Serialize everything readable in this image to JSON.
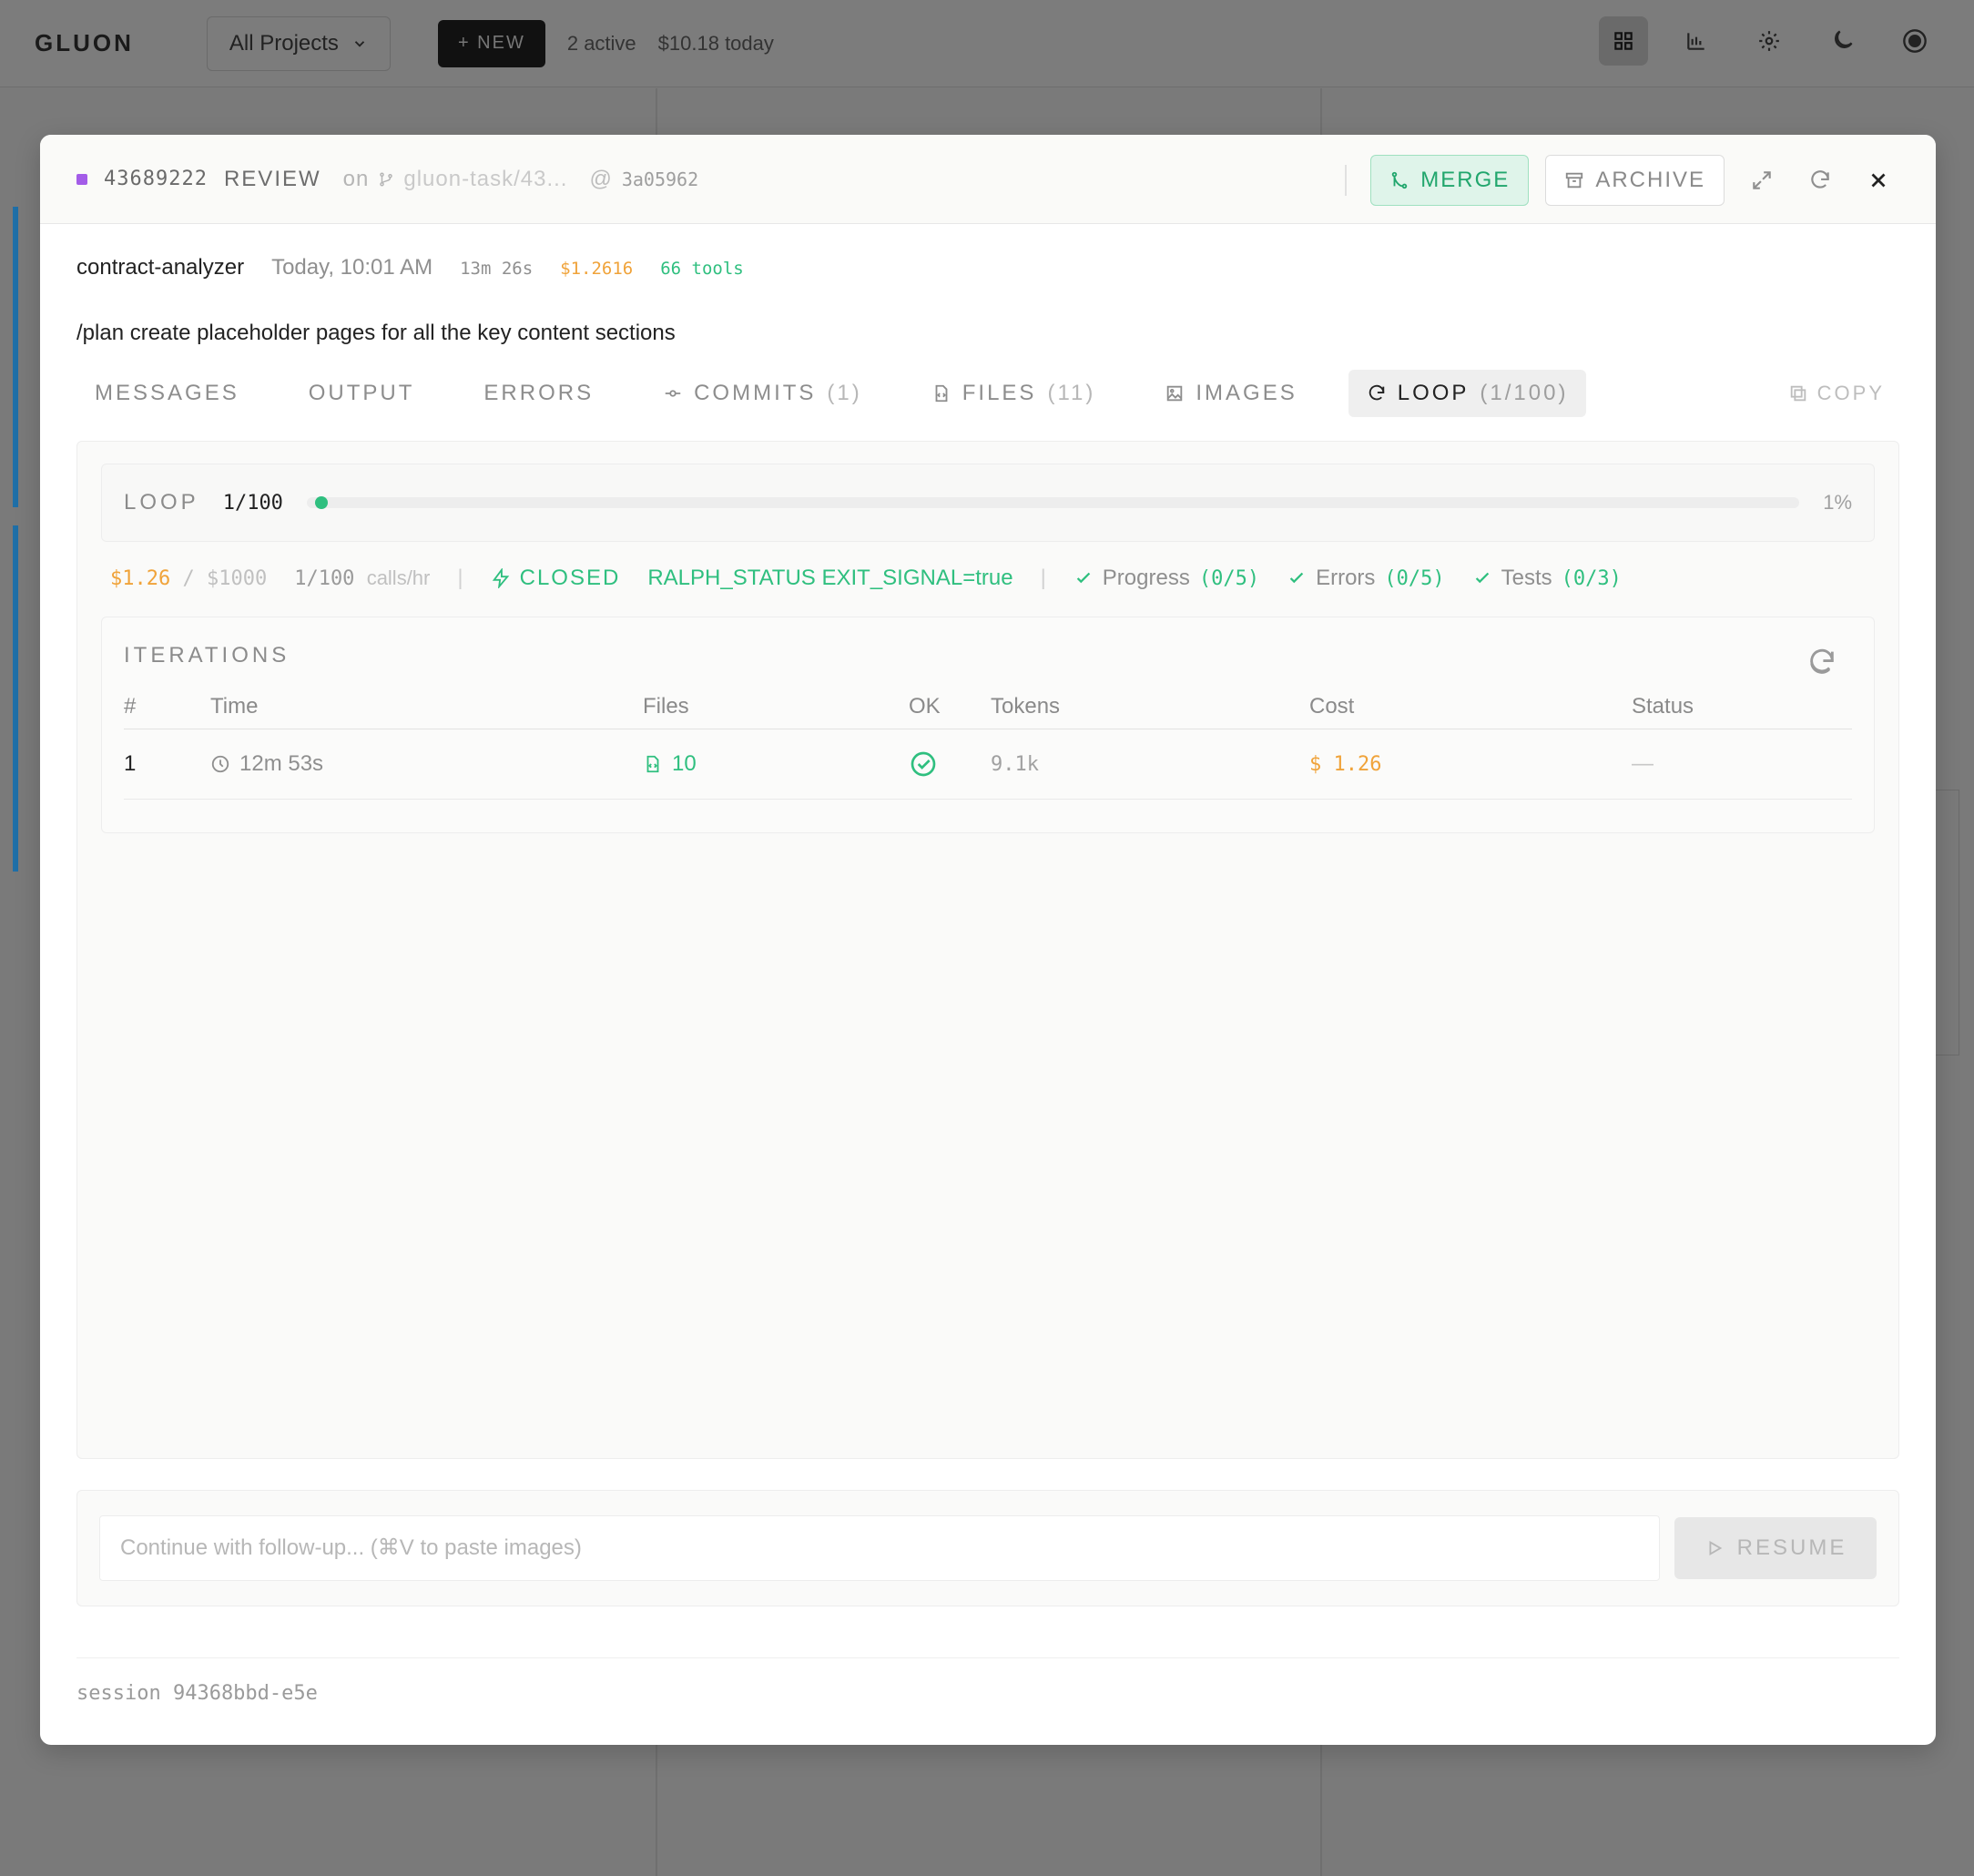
{
  "app": {
    "logo": "GLUON",
    "project_select": "All Projects",
    "new_button": "+ NEW",
    "active_count": "2 active",
    "spend_today": "$10.18 today"
  },
  "modal": {
    "header": {
      "task_id": "43689222",
      "status": "REVIEW",
      "on_label": "on",
      "branch": "gluon-task/43...",
      "at_label": "@",
      "commit": "3a05962",
      "merge_label": "MERGE",
      "archive_label": "ARCHIVE"
    },
    "meta": {
      "agent": "contract-analyzer",
      "date": "Today, 10:01 AM",
      "duration": "13m 26s",
      "cost": "$1.2616",
      "tools": "66 tools"
    },
    "prompt": "/plan create placeholder pages for all the key content sections",
    "tabs": [
      {
        "label": "MESSAGES",
        "count": ""
      },
      {
        "label": "OUTPUT",
        "count": ""
      },
      {
        "label": "ERRORS",
        "count": ""
      },
      {
        "label": "COMMITS",
        "count": "(1)"
      },
      {
        "label": "FILES",
        "count": "(11)"
      },
      {
        "label": "IMAGES",
        "count": ""
      },
      {
        "label": "LOOP",
        "count": "(1/100)"
      }
    ],
    "copy_label": "COPY",
    "loop": {
      "label": "LOOP",
      "count": "1/100",
      "progress": 0.01,
      "pct": "1%"
    },
    "stats": {
      "spent": "$1.26",
      "limit": "/ $1000",
      "calls_value": "1/100",
      "calls_unit": "calls/hr",
      "circuit": "CLOSED",
      "ralph": "RALPH_STATUS EXIT_SIGNAL=true",
      "progress_label": "Progress",
      "progress_value": "(0/5)",
      "errors_label": "Errors",
      "errors_value": "(0/5)",
      "tests_label": "Tests",
      "tests_value": "(0/3)"
    },
    "iterations": {
      "title": "ITERATIONS",
      "headers": [
        "#",
        "Time",
        "Files",
        "OK",
        "Tokens",
        "Cost",
        "Status"
      ],
      "rows": [
        {
          "num": "1",
          "time": "12m 53s",
          "files": "10",
          "tokens": "9.1k",
          "cost": "1.26",
          "status": "—"
        }
      ]
    },
    "followup": {
      "placeholder": "Continue with follow-up... (⌘V to paste images)",
      "resume_label": "RESUME"
    },
    "footer": {
      "session": "session 94368bbd-e5e"
    }
  }
}
